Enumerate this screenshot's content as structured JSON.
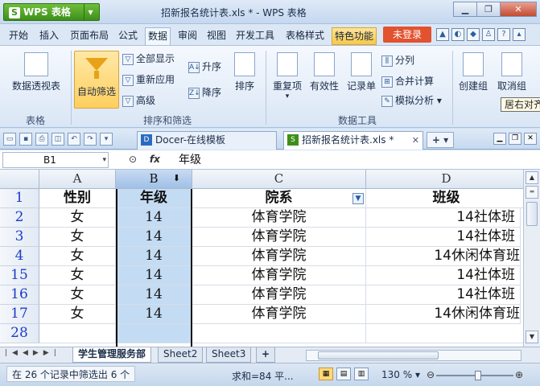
{
  "app": {
    "button_label": "WPS 表格",
    "title": "招新报名统计表.xls * - WPS 表格"
  },
  "menu": {
    "tabs": [
      "开始",
      "插入",
      "页面布局",
      "公式",
      "数据",
      "审阅",
      "视图",
      "开发工具",
      "表格样式",
      "特色功能"
    ],
    "active": "数据",
    "login": "未登录"
  },
  "ribbon": {
    "pivot": "数据透视表",
    "autofilter": "自动筛选",
    "show_all": "全部显示",
    "reapply": "重新应用",
    "advanced": "高级",
    "sort_asc": "升序",
    "sort_desc": "降序",
    "sort": "排序",
    "duplicates": "重复项",
    "validity": "有效性",
    "record": "记录单",
    "split": "分列",
    "consolidate": "合并计算",
    "whatif": "模拟分析",
    "create_group": "创建组",
    "ungroup": "取消组",
    "groups": {
      "table": "表格",
      "sort_filter": "排序和筛选",
      "data_tools": "数据工具"
    },
    "tooltip": "居右对齐"
  },
  "doc_tabs": [
    {
      "label": "Docer-在线模板"
    },
    {
      "label": "招新报名统计表.xls *"
    }
  ],
  "formula": {
    "cell_ref": "B1",
    "value": "年级"
  },
  "grid": {
    "columns": [
      "A",
      "B",
      "C",
      "D"
    ],
    "selected_column": "B",
    "rows": [
      {
        "num": "1",
        "cells": [
          "性别",
          "年级",
          "院系",
          "班级"
        ]
      },
      {
        "num": "2",
        "cells": [
          "女",
          "14",
          "体育学院",
          "14社体班"
        ]
      },
      {
        "num": "3",
        "cells": [
          "女",
          "14",
          "体育学院",
          "14社体班"
        ]
      },
      {
        "num": "4",
        "cells": [
          "女",
          "14",
          "体育学院",
          "14休闲体育班"
        ]
      },
      {
        "num": "15",
        "cells": [
          "女",
          "14",
          "体育学院",
          "14社体班"
        ]
      },
      {
        "num": "16",
        "cells": [
          "女",
          "14",
          "体育学院",
          "14社体班"
        ]
      },
      {
        "num": "17",
        "cells": [
          "女",
          "14",
          "体育学院",
          "14休闲体育班"
        ]
      },
      {
        "num": "28",
        "cells": [
          "",
          "",
          "",
          ""
        ]
      }
    ]
  },
  "sheets": [
    "学生管理服务部",
    "Sheet2",
    "Sheet3"
  ],
  "status": {
    "filter_info": "在 26 个记录中筛选出 6 个",
    "sum": "求和=84  平...",
    "zoom": "130 %"
  }
}
